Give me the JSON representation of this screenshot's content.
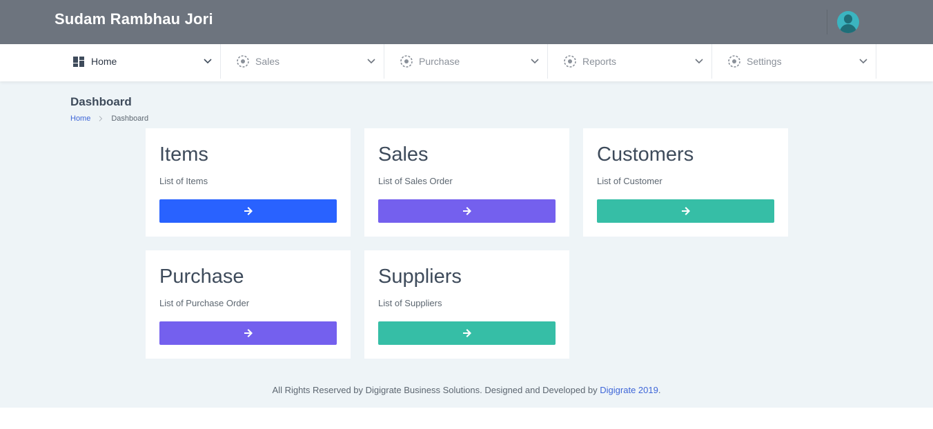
{
  "header": {
    "brand": "Sudam Rambhau Jori"
  },
  "nav": {
    "items": [
      {
        "label": "Home",
        "icon": "dashboard-grid-icon"
      },
      {
        "label": "Sales",
        "icon": "dotted-circle-icon"
      },
      {
        "label": "Purchase",
        "icon": "dotted-circle-icon"
      },
      {
        "label": "Reports",
        "icon": "dotted-circle-icon"
      },
      {
        "label": "Settings",
        "icon": "dotted-circle-icon"
      }
    ]
  },
  "page": {
    "title": "Dashboard",
    "breadcrumb": {
      "home": "Home",
      "current": "Dashboard"
    }
  },
  "cards": [
    {
      "title": "Items",
      "subtitle": "List of Items",
      "color": "#2962ff"
    },
    {
      "title": "Sales",
      "subtitle": "List of Sales Order",
      "color": "#7460ee"
    },
    {
      "title": "Customers",
      "subtitle": "List of Customer",
      "color": "#36bea6"
    },
    {
      "title": "Purchase",
      "subtitle": "List of Purchase Order",
      "color": "#7460ee"
    },
    {
      "title": "Suppliers",
      "subtitle": "List of Suppliers",
      "color": "#36bea6"
    }
  ],
  "footer": {
    "text": "All Rights Reserved by Digigrate Business Solutions. Designed and Developed by ",
    "link": "Digigrate 2019",
    "end": "."
  },
  "colors": {
    "topbar": "#6d747e",
    "content_bg": "#eef4f7",
    "link": "#3e66d8"
  }
}
